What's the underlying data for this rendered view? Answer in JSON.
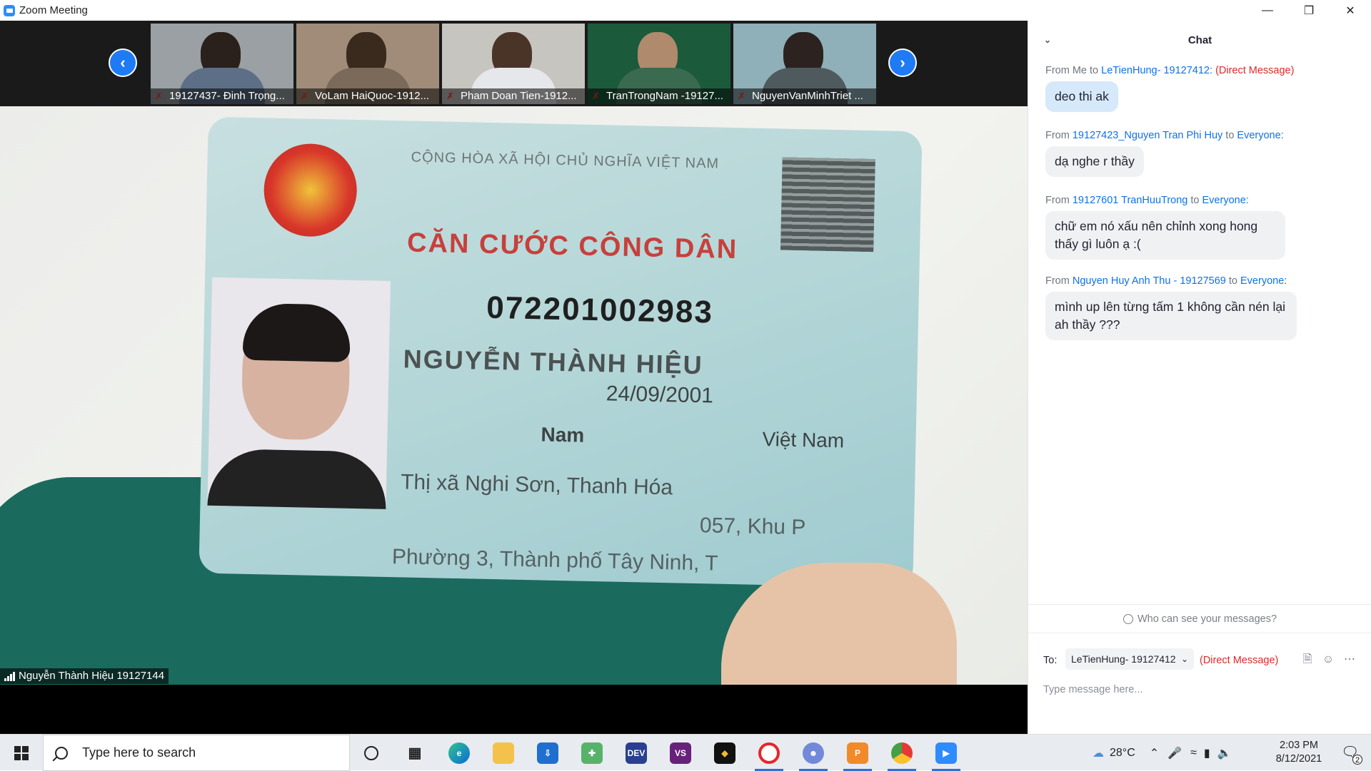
{
  "window": {
    "title": "Zoom Meeting",
    "controls": [
      "minimize",
      "restore",
      "close"
    ]
  },
  "gallery": {
    "participants": [
      {
        "name": "19127437- Đinh Trọng...",
        "muted": true
      },
      {
        "name": "VoLam HaiQuoc-1912...",
        "muted": true
      },
      {
        "name": "Pham Doan Tien-1912...",
        "muted": true
      },
      {
        "name": "TranTrongNam -19127...",
        "muted": true
      },
      {
        "name": "NguyenVanMinhTriet ...",
        "muted": true
      }
    ]
  },
  "main_video": {
    "speaker_name": "Nguyễn Thành Hiệu 19127144",
    "id_card": {
      "header": "CỘNG HÒA XÃ HỘI CHỦ NGHĨA VIỆT NAM",
      "title": "CĂN CƯỚC CÔNG DÂN",
      "number": "072201002983",
      "name": "NGUYỄN THÀNH HIỆU",
      "dob": "24/09/2001",
      "sex": "Nam",
      "nationality": "Việt Nam",
      "origin": "Thị xã Nghi Sơn, Thanh Hóa",
      "address_1": "057, Khu P",
      "address_2": "Phường 3, Thành phố Tây Ninh, T"
    }
  },
  "chat": {
    "title": "Chat",
    "messages": [
      {
        "from_prefix": "From Me to ",
        "from": "LeTienHung- 19127412:",
        "to_word": "",
        "to": "",
        "dm": "(Direct Message)",
        "text": "deo thi ak",
        "mine": true
      },
      {
        "from_prefix": "From ",
        "from": "19127423_Nguyen Tran Phi Huy",
        "to_word": " to ",
        "to": "Everyone:",
        "dm": "",
        "text": "dạ nghe r thầy",
        "mine": false
      },
      {
        "from_prefix": "From ",
        "from": "19127601 TranHuuTrong",
        "to_word": " to ",
        "to": "Everyone:",
        "dm": "",
        "text": "chữ em nó xấu nên chỉnh xong hong thấy gì luôn ạ :(",
        "mine": false
      },
      {
        "from_prefix": "From ",
        "from": "Nguyen Huy Anh Thu - 19127569",
        "to_word": " to ",
        "to": "Everyone:",
        "dm": "",
        "text": "mình up lên từng tấm 1 không cần nén lại ah thầy ???",
        "mine": false
      }
    ],
    "privacy_text": "Who can see your messages?",
    "to_label": "To:",
    "recipient": "LeTienHung- 19127412",
    "direct_message": "(Direct Message)",
    "input_placeholder": "Type message here..."
  },
  "taskbar": {
    "search_placeholder": "Type here to search",
    "apps": [
      "task-view",
      "edge",
      "file-explorer",
      "installer",
      "network",
      "dev-cpp",
      "visual-studio",
      "binance",
      "opera",
      "discord",
      "paper",
      "chrome",
      "zoom"
    ],
    "weather": "28°C",
    "time": "2:03 PM",
    "date": "8/12/2021",
    "notifications": "2"
  },
  "colors": {
    "accent": "#0e71eb",
    "direct_message": "#e02828",
    "zoom_blue": "#2d8cff"
  }
}
